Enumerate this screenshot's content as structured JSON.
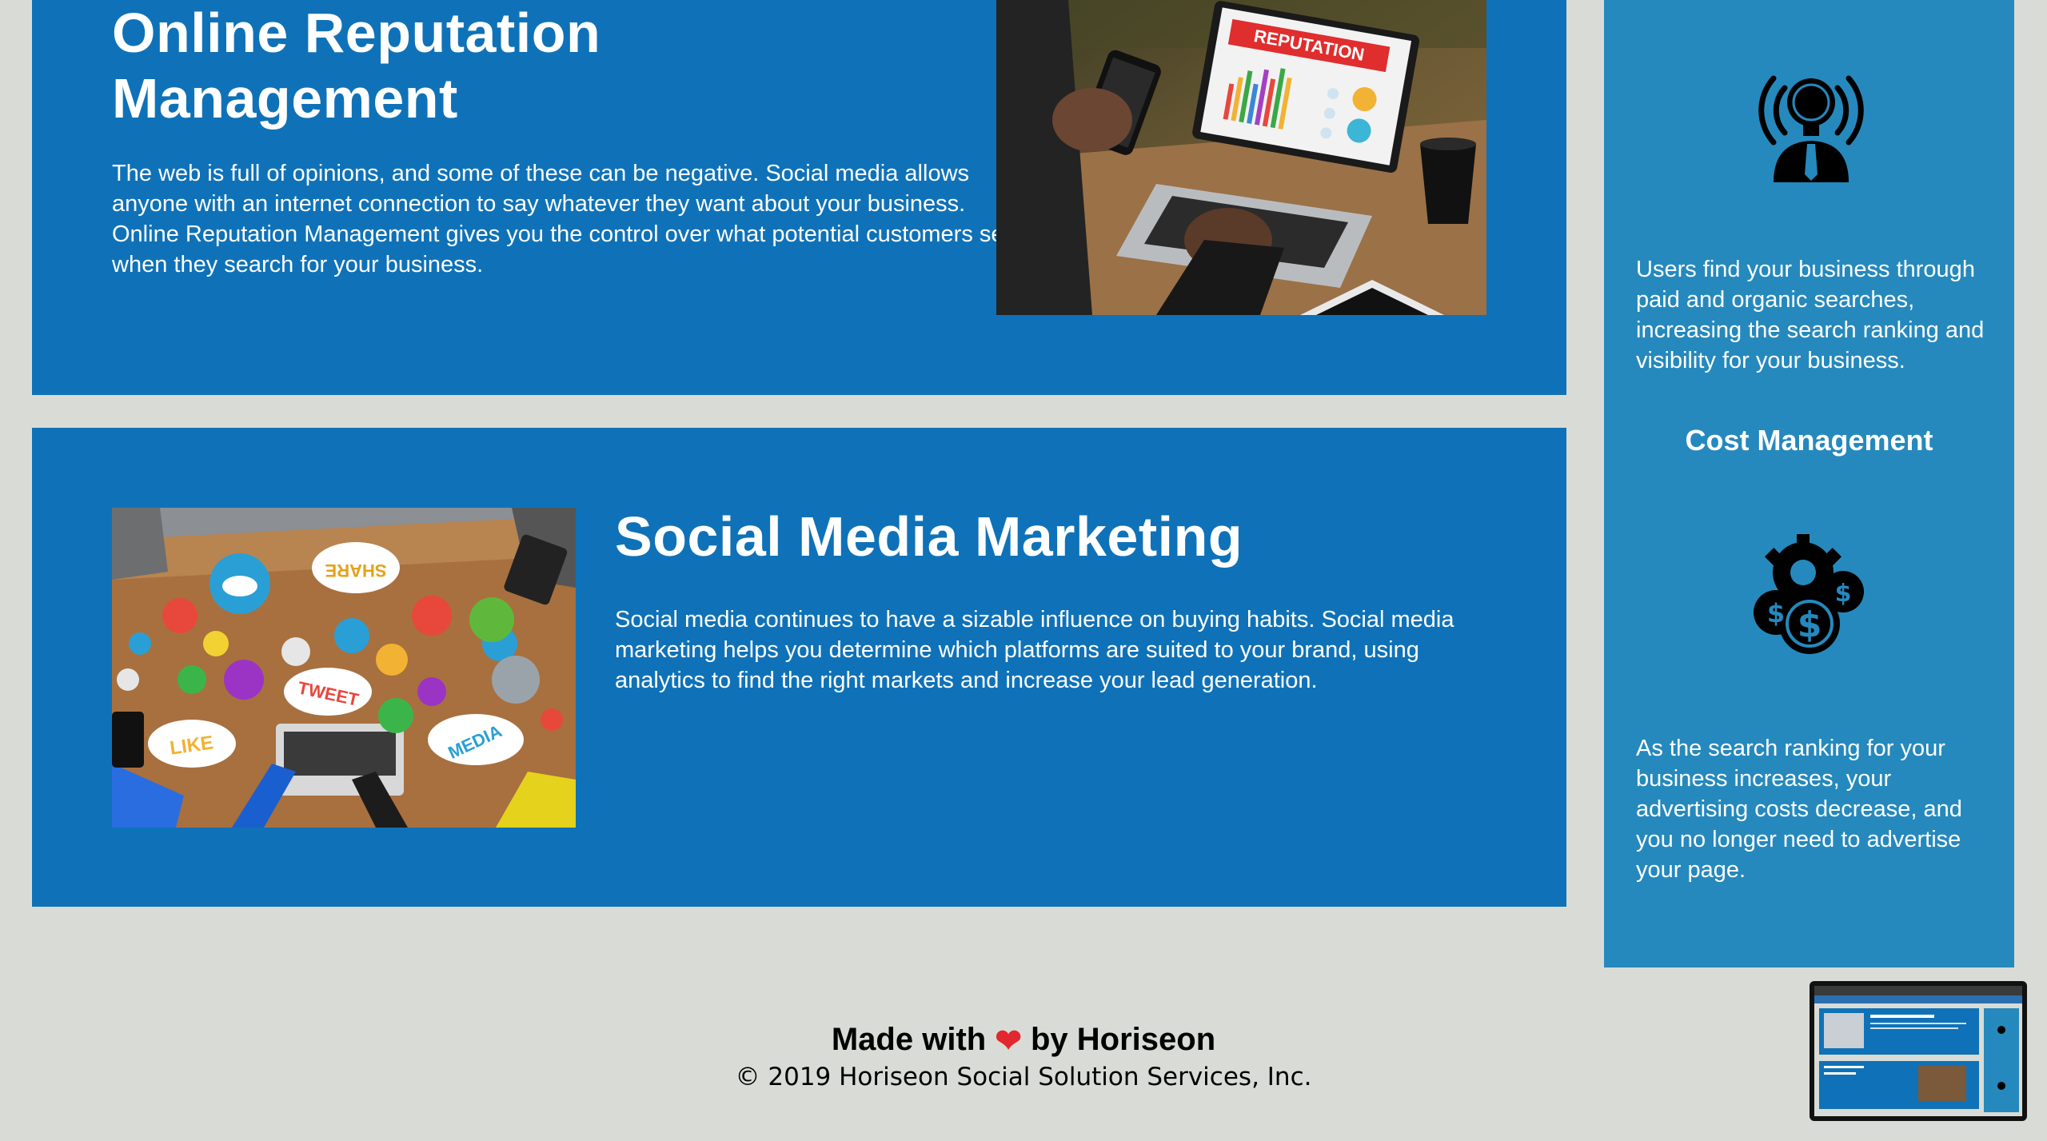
{
  "orm": {
    "title_line1": "Online Reputation",
    "title_line2": "Management",
    "body": "The web is full of opinions, and some of these can be negative. Social media allows anyone with an internet connection to say whatever they want about your business. Online Reputation Management gives you the control over what potential customers see when they search for your business.",
    "photo_label": "REPUTATION"
  },
  "smm": {
    "title": "Social Media Marketing",
    "body": "Social media continues to have a sizable influence on buying habits. Social media marketing helps you determine which platforms are suited to your brand, using analytics to find the right markets and increase your lead generation.",
    "bubble_share": "SHARE",
    "bubble_tweet": "TWEET",
    "bubble_like": "LIKE",
    "bubble_media": "MEDIA"
  },
  "sidebar": {
    "text1": "Users find your business through paid and organic searches, increasing the search ranking and visibility for your business.",
    "heading2": "Cost Management",
    "text2": "As the search ranking for your business increases, your advertising costs decrease, and you no longer need to advertise your page.",
    "icon1": "lightbulb-person-icon",
    "icon2": "gear-dollar-icon"
  },
  "footer": {
    "made_with": "Made with",
    "by": "by Horiseon",
    "heart": "❤",
    "copyright": "© 2019 Horiseon Social Solution Services, Inc."
  },
  "colors": {
    "card_blue": "#0f72b8",
    "sidebar_blue": "#2589bd",
    "page_bg": "#d9dcd6",
    "heart_red": "#e0282e"
  }
}
